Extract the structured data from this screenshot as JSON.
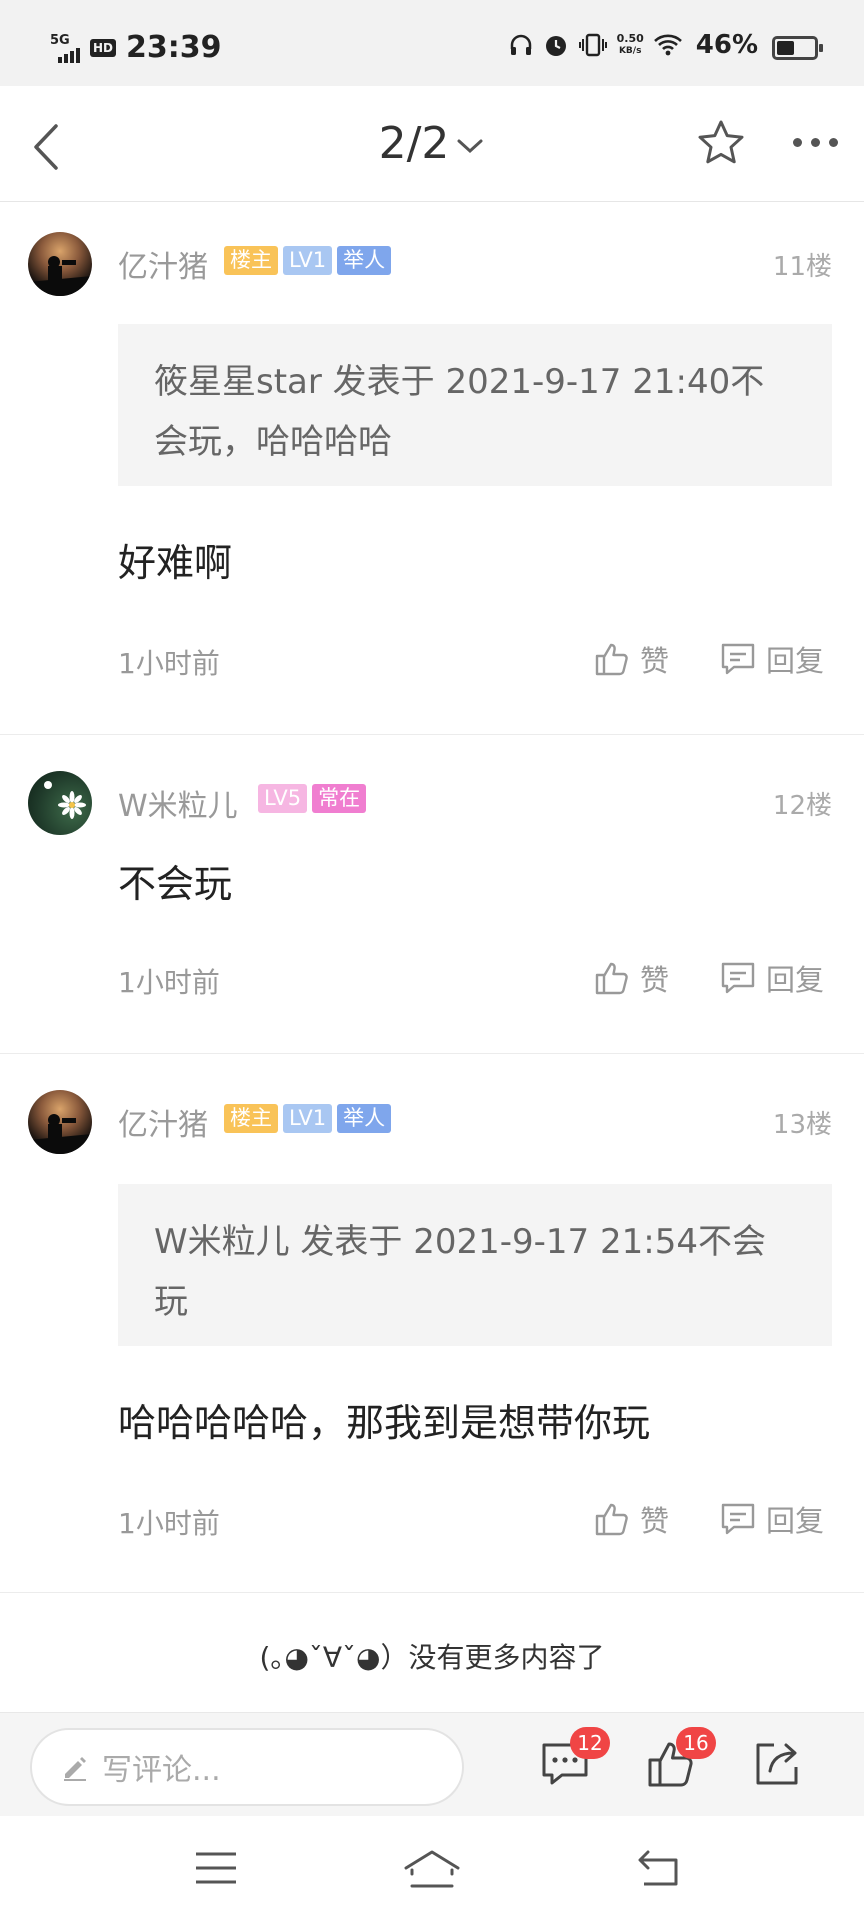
{
  "status_bar": {
    "network": "5G",
    "hd": "HD",
    "time": "23:39",
    "speed_value": "0.50",
    "speed_unit": "KB/s",
    "battery": "46%",
    "battery_level": 0.46
  },
  "nav": {
    "page_indicator": "2/2"
  },
  "posts": [
    {
      "username": "亿汁猪",
      "badges": [
        "楼主",
        "LV1",
        "举人"
      ],
      "floor": "11楼",
      "quote": "筱星星star 发表于 2021-9-17 21:40不会玩，哈哈哈哈",
      "content": "好难啊",
      "time": "1小时前",
      "like_label": "赞",
      "reply_label": "回复"
    },
    {
      "username": "W米粒儿",
      "badges": [
        "LV5",
        "常在"
      ],
      "floor": "12楼",
      "content": "不会玩",
      "time": "1小时前",
      "like_label": "赞",
      "reply_label": "回复"
    },
    {
      "username": "亿汁猪",
      "badges": [
        "楼主",
        "LV1",
        "举人"
      ],
      "floor": "13楼",
      "quote": "W米粒儿 发表于 2021-9-17 21:54不会玩",
      "content": "哈哈哈哈哈，那我到是想带你玩",
      "time": "1小时前",
      "like_label": "赞",
      "reply_label": "回复"
    }
  ],
  "no_more": "(｡◕ˇ∀ˇ◕）没有更多内容了",
  "comment_bar": {
    "placeholder": "写评论...",
    "comment_count": "12",
    "like_count": "16"
  },
  "colors": {
    "badge_owner": "#f9c358",
    "badge_lv1": "#a9c7f2",
    "badge_rank": "#7fa6ec",
    "badge_lv5": "#f6b6e2",
    "badge_active": "#f07ed0",
    "count_badge": "#f04545"
  }
}
